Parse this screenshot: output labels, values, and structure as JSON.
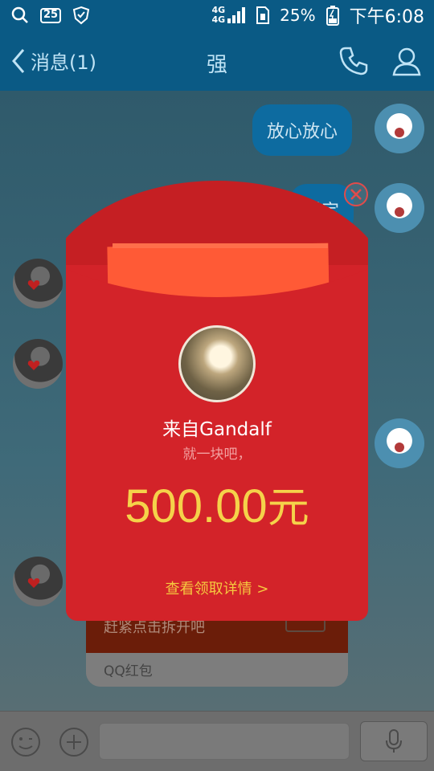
{
  "status_bar": {
    "network_top": "4G",
    "network_bottom": "4G",
    "battery_percent": "25%",
    "time": "下午6:08",
    "badge": "25"
  },
  "header": {
    "back_label": "消息(1)",
    "title": "强"
  },
  "chat": {
    "messages": [
      {
        "from": "me",
        "text": "放心放心"
      },
      {
        "from": "me",
        "text": "说定"
      }
    ],
    "red_packet_card": {
      "hint": "赶紧点击拆开吧",
      "label": "QQ红包"
    }
  },
  "popup": {
    "sender": "来自Gandalf",
    "message": "就一块吧，",
    "amount": "500.00",
    "unit": "元",
    "details_link": "查看领取详情 >",
    "accent_color": "#d32329",
    "amount_color": "#f5d24a"
  }
}
